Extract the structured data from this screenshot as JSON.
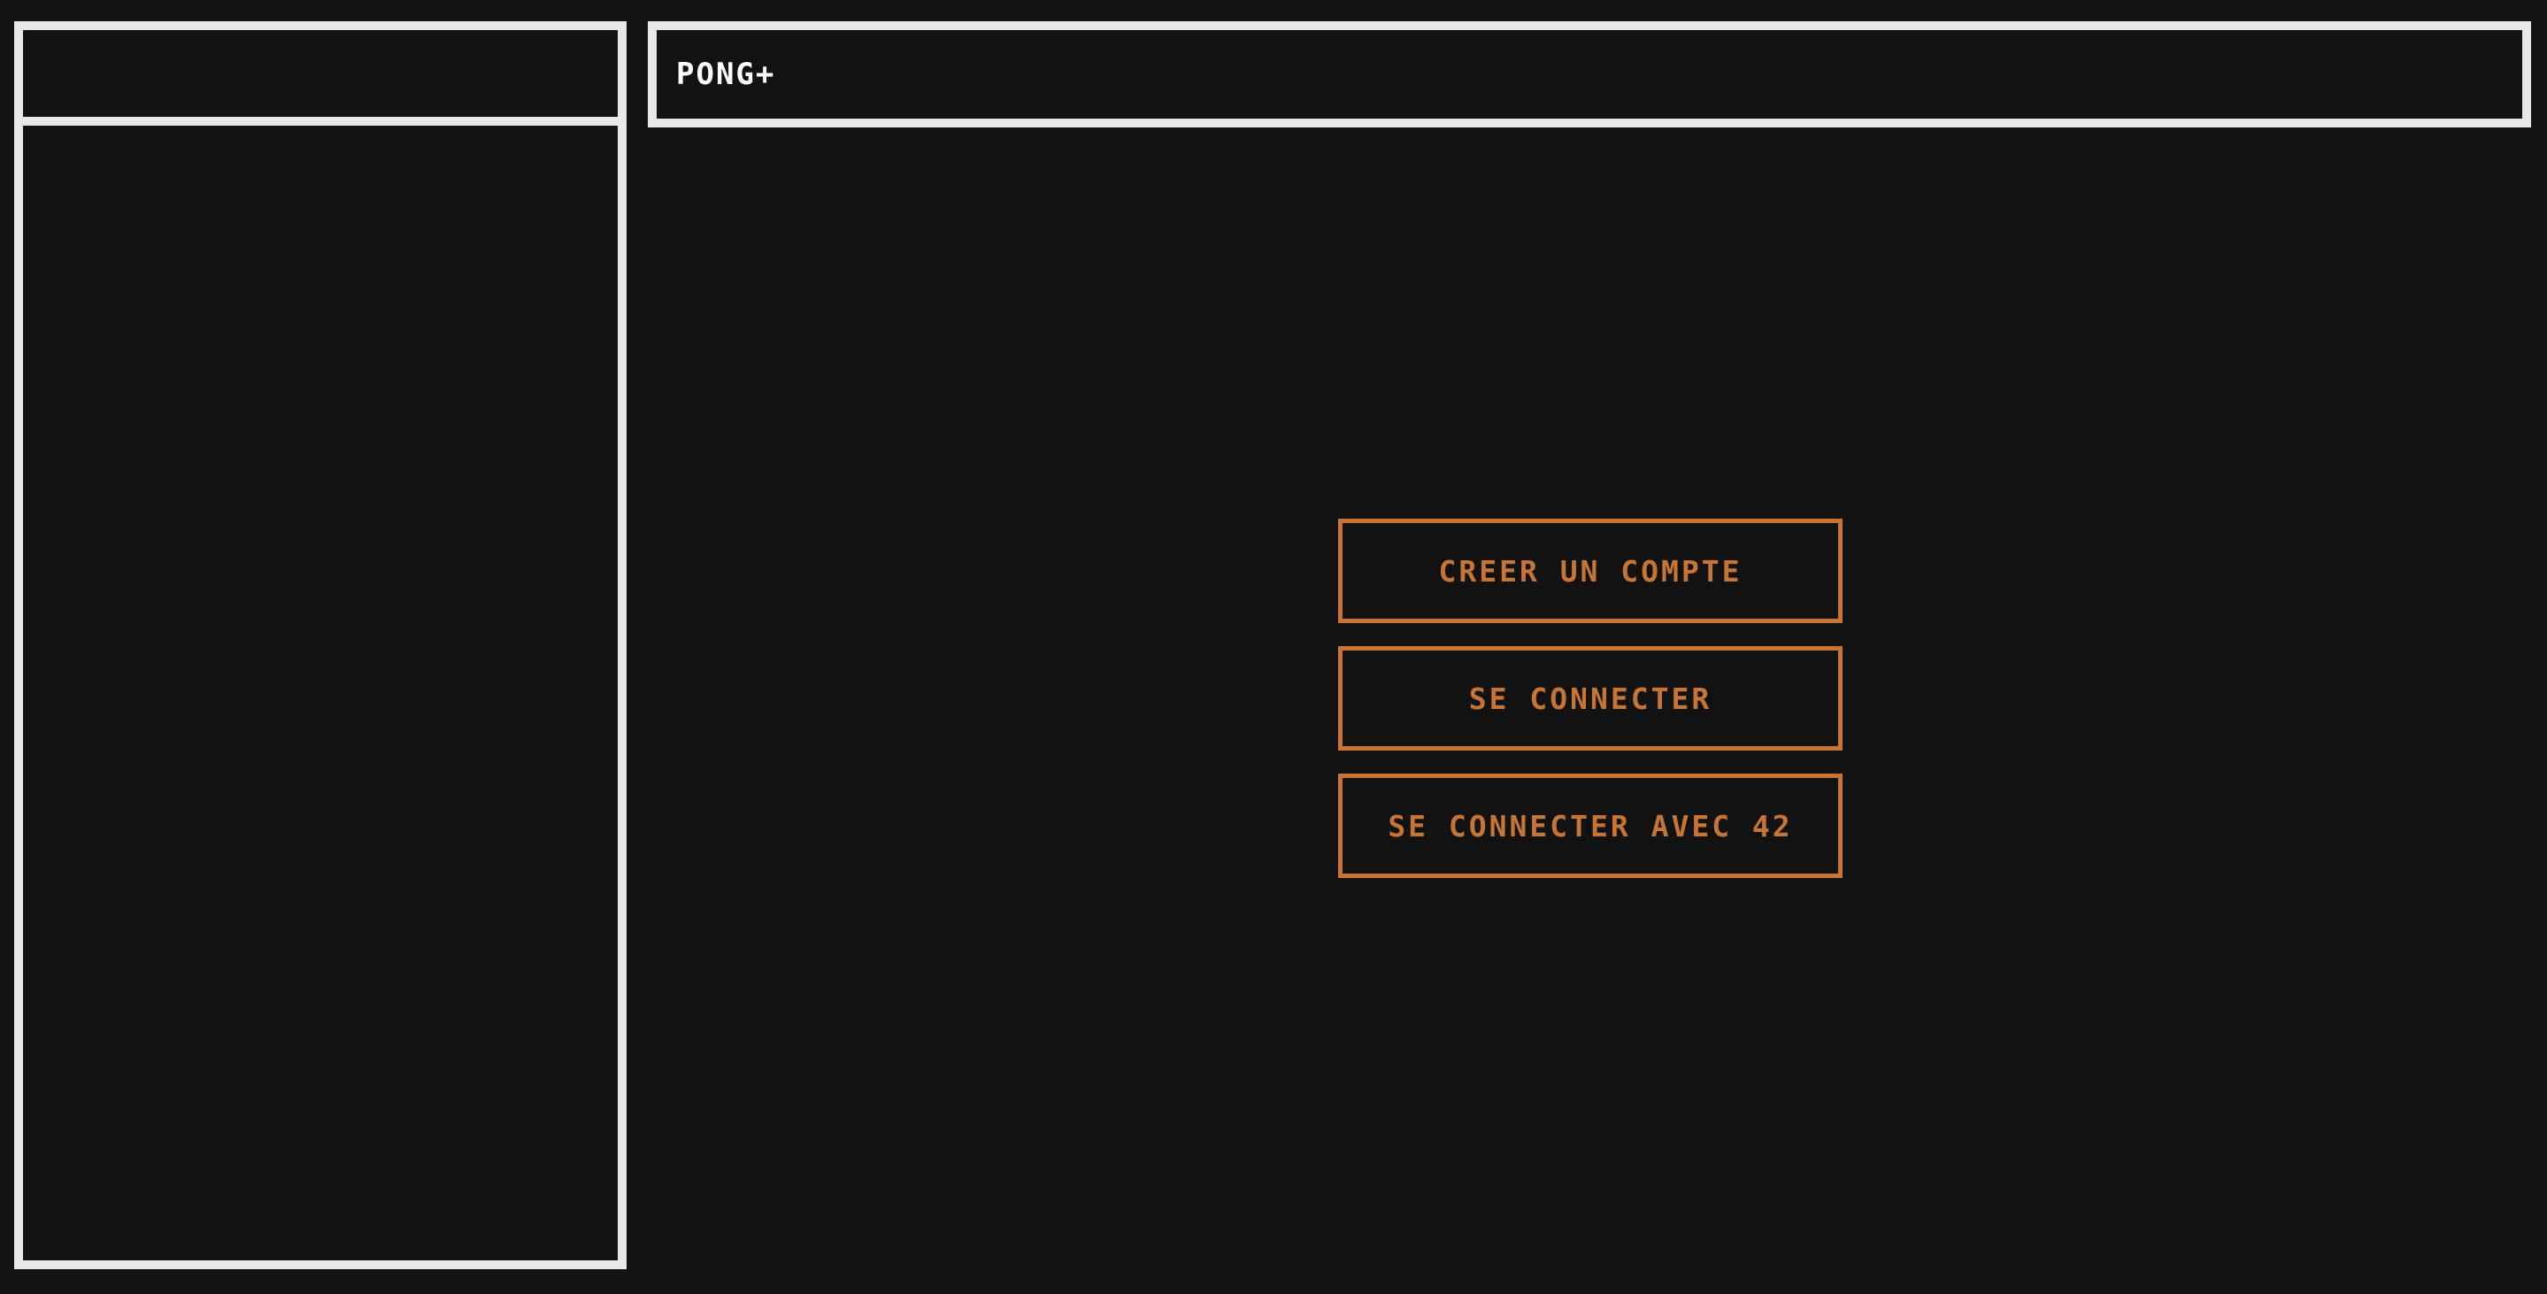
{
  "header": {
    "app_title": "PONG+"
  },
  "auth": {
    "create_account_label": "CREER UN COMPTE",
    "login_label": "SE CONNECTER",
    "login_42_label": "SE CONNECTER AVEC 42"
  },
  "colors": {
    "background": "#121212",
    "frame_border": "#e8e8e8",
    "accent": "#c87533",
    "title_text": "#ffffff"
  }
}
